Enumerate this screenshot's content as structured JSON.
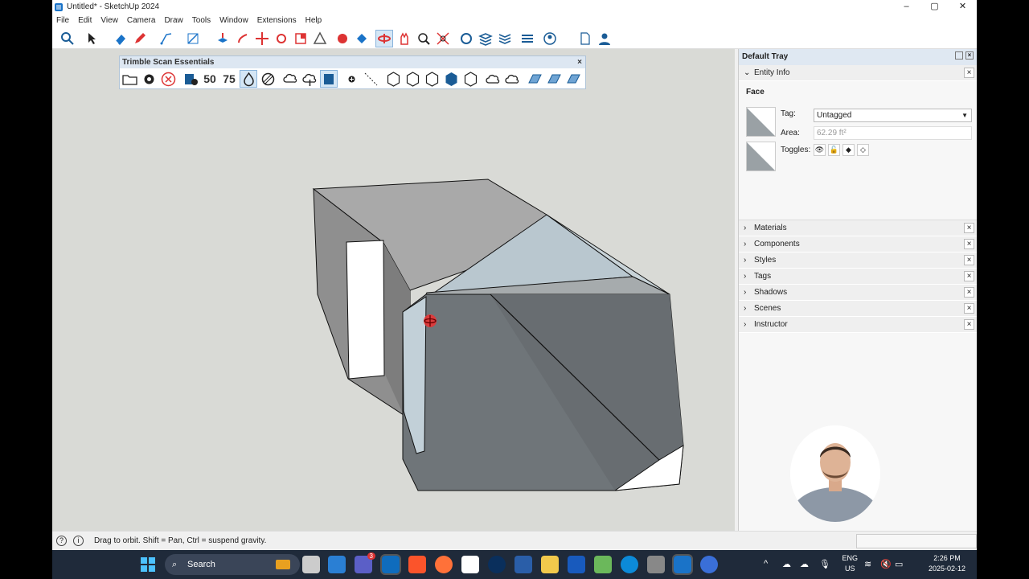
{
  "window": {
    "title": "Untitled* - SketchUp 2024",
    "minimize": "–",
    "maximize": "▢",
    "close": "✕"
  },
  "menu": [
    "File",
    "Edit",
    "View",
    "Camera",
    "Draw",
    "Tools",
    "Window",
    "Extensions",
    "Help"
  ],
  "scan_toolbar": {
    "title": "Trimble Scan Essentials",
    "close": "×",
    "label_50": "50",
    "label_75": "75"
  },
  "tray": {
    "title": "Default Tray",
    "entity_info": {
      "label": "Entity Info",
      "type": "Face",
      "tag_label": "Tag:",
      "tag_value": "Untagged",
      "area_label": "Area:",
      "area_value": "62.29 ft²",
      "toggles_label": "Toggles:"
    },
    "panels": [
      "Materials",
      "Components",
      "Styles",
      "Tags",
      "Shadows",
      "Scenes",
      "Instructor"
    ]
  },
  "status": {
    "text": "Drag to orbit. Shift = Pan, Ctrl = suspend gravity."
  },
  "taskbar": {
    "search_placeholder": "Search",
    "badge": "3",
    "lang_top": "ENG",
    "lang_bottom": "US",
    "time": "2:26 PM",
    "date": "2025-02-12"
  },
  "colors": {
    "accent": "#1a73c8",
    "viewport_bg": "#d9dad6",
    "tray_header": "#dfe8f2",
    "taskbar": "#1f2a3a"
  }
}
